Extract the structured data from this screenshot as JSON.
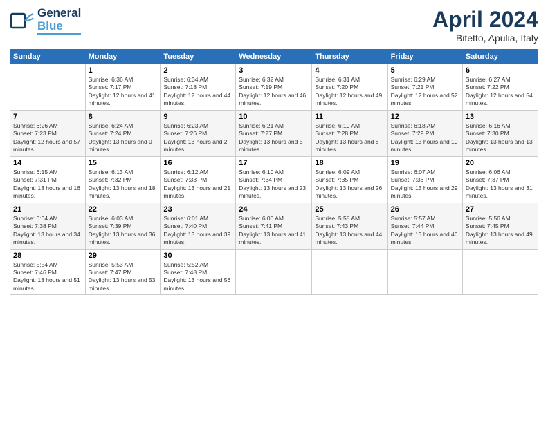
{
  "logo": {
    "line1": "General",
    "line2": "Blue"
  },
  "title": "April 2024",
  "subtitle": "Bitetto, Apulia, Italy",
  "days": [
    "Sunday",
    "Monday",
    "Tuesday",
    "Wednesday",
    "Thursday",
    "Friday",
    "Saturday"
  ],
  "weeks": [
    [
      {
        "date": "",
        "sunrise": "",
        "sunset": "",
        "daylight": ""
      },
      {
        "date": "1",
        "sunrise": "Sunrise: 6:36 AM",
        "sunset": "Sunset: 7:17 PM",
        "daylight": "Daylight: 12 hours and 41 minutes."
      },
      {
        "date": "2",
        "sunrise": "Sunrise: 6:34 AM",
        "sunset": "Sunset: 7:18 PM",
        "daylight": "Daylight: 12 hours and 44 minutes."
      },
      {
        "date": "3",
        "sunrise": "Sunrise: 6:32 AM",
        "sunset": "Sunset: 7:19 PM",
        "daylight": "Daylight: 12 hours and 46 minutes."
      },
      {
        "date": "4",
        "sunrise": "Sunrise: 6:31 AM",
        "sunset": "Sunset: 7:20 PM",
        "daylight": "Daylight: 12 hours and 49 minutes."
      },
      {
        "date": "5",
        "sunrise": "Sunrise: 6:29 AM",
        "sunset": "Sunset: 7:21 PM",
        "daylight": "Daylight: 12 hours and 52 minutes."
      },
      {
        "date": "6",
        "sunrise": "Sunrise: 6:27 AM",
        "sunset": "Sunset: 7:22 PM",
        "daylight": "Daylight: 12 hours and 54 minutes."
      }
    ],
    [
      {
        "date": "7",
        "sunrise": "Sunrise: 6:26 AM",
        "sunset": "Sunset: 7:23 PM",
        "daylight": "Daylight: 12 hours and 57 minutes."
      },
      {
        "date": "8",
        "sunrise": "Sunrise: 6:24 AM",
        "sunset": "Sunset: 7:24 PM",
        "daylight": "Daylight: 13 hours and 0 minutes."
      },
      {
        "date": "9",
        "sunrise": "Sunrise: 6:23 AM",
        "sunset": "Sunset: 7:26 PM",
        "daylight": "Daylight: 13 hours and 2 minutes."
      },
      {
        "date": "10",
        "sunrise": "Sunrise: 6:21 AM",
        "sunset": "Sunset: 7:27 PM",
        "daylight": "Daylight: 13 hours and 5 minutes."
      },
      {
        "date": "11",
        "sunrise": "Sunrise: 6:19 AM",
        "sunset": "Sunset: 7:28 PM",
        "daylight": "Daylight: 13 hours and 8 minutes."
      },
      {
        "date": "12",
        "sunrise": "Sunrise: 6:18 AM",
        "sunset": "Sunset: 7:29 PM",
        "daylight": "Daylight: 13 hours and 10 minutes."
      },
      {
        "date": "13",
        "sunrise": "Sunrise: 6:16 AM",
        "sunset": "Sunset: 7:30 PM",
        "daylight": "Daylight: 13 hours and 13 minutes."
      }
    ],
    [
      {
        "date": "14",
        "sunrise": "Sunrise: 6:15 AM",
        "sunset": "Sunset: 7:31 PM",
        "daylight": "Daylight: 13 hours and 16 minutes."
      },
      {
        "date": "15",
        "sunrise": "Sunrise: 6:13 AM",
        "sunset": "Sunset: 7:32 PM",
        "daylight": "Daylight: 13 hours and 18 minutes."
      },
      {
        "date": "16",
        "sunrise": "Sunrise: 6:12 AM",
        "sunset": "Sunset: 7:33 PM",
        "daylight": "Daylight: 13 hours and 21 minutes."
      },
      {
        "date": "17",
        "sunrise": "Sunrise: 6:10 AM",
        "sunset": "Sunset: 7:34 PM",
        "daylight": "Daylight: 13 hours and 23 minutes."
      },
      {
        "date": "18",
        "sunrise": "Sunrise: 6:09 AM",
        "sunset": "Sunset: 7:35 PM",
        "daylight": "Daylight: 13 hours and 26 minutes."
      },
      {
        "date": "19",
        "sunrise": "Sunrise: 6:07 AM",
        "sunset": "Sunset: 7:36 PM",
        "daylight": "Daylight: 13 hours and 29 minutes."
      },
      {
        "date": "20",
        "sunrise": "Sunrise: 6:06 AM",
        "sunset": "Sunset: 7:37 PM",
        "daylight": "Daylight: 13 hours and 31 minutes."
      }
    ],
    [
      {
        "date": "21",
        "sunrise": "Sunrise: 6:04 AM",
        "sunset": "Sunset: 7:38 PM",
        "daylight": "Daylight: 13 hours and 34 minutes."
      },
      {
        "date": "22",
        "sunrise": "Sunrise: 6:03 AM",
        "sunset": "Sunset: 7:39 PM",
        "daylight": "Daylight: 13 hours and 36 minutes."
      },
      {
        "date": "23",
        "sunrise": "Sunrise: 6:01 AM",
        "sunset": "Sunset: 7:40 PM",
        "daylight": "Daylight: 13 hours and 39 minutes."
      },
      {
        "date": "24",
        "sunrise": "Sunrise: 6:00 AM",
        "sunset": "Sunset: 7:41 PM",
        "daylight": "Daylight: 13 hours and 41 minutes."
      },
      {
        "date": "25",
        "sunrise": "Sunrise: 5:58 AM",
        "sunset": "Sunset: 7:43 PM",
        "daylight": "Daylight: 13 hours and 44 minutes."
      },
      {
        "date": "26",
        "sunrise": "Sunrise: 5:57 AM",
        "sunset": "Sunset: 7:44 PM",
        "daylight": "Daylight: 13 hours and 46 minutes."
      },
      {
        "date": "27",
        "sunrise": "Sunrise: 5:56 AM",
        "sunset": "Sunset: 7:45 PM",
        "daylight": "Daylight: 13 hours and 49 minutes."
      }
    ],
    [
      {
        "date": "28",
        "sunrise": "Sunrise: 5:54 AM",
        "sunset": "Sunset: 7:46 PM",
        "daylight": "Daylight: 13 hours and 51 minutes."
      },
      {
        "date": "29",
        "sunrise": "Sunrise: 5:53 AM",
        "sunset": "Sunset: 7:47 PM",
        "daylight": "Daylight: 13 hours and 53 minutes."
      },
      {
        "date": "30",
        "sunrise": "Sunrise: 5:52 AM",
        "sunset": "Sunset: 7:48 PM",
        "daylight": "Daylight: 13 hours and 56 minutes."
      },
      {
        "date": "",
        "sunrise": "",
        "sunset": "",
        "daylight": ""
      },
      {
        "date": "",
        "sunrise": "",
        "sunset": "",
        "daylight": ""
      },
      {
        "date": "",
        "sunrise": "",
        "sunset": "",
        "daylight": ""
      },
      {
        "date": "",
        "sunrise": "",
        "sunset": "",
        "daylight": ""
      }
    ]
  ]
}
